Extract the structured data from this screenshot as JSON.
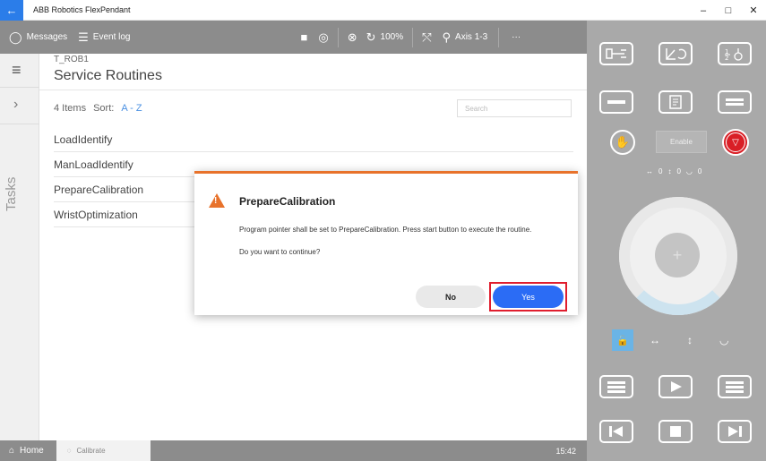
{
  "window": {
    "title": "ABB Robotics FlexPendant",
    "back_icon": "arrow-left-icon",
    "minimize": "–",
    "maximize": "□",
    "close": "✕"
  },
  "toolbar": {
    "messages_label": "Messages",
    "eventlog_label": "Event log",
    "speed_label": "100%",
    "axis_label": "Axis 1-3",
    "more_label": "···"
  },
  "rail": {
    "tasks_label": "Tasks"
  },
  "header": {
    "robot": "T_ROB1",
    "title": "Service Routines"
  },
  "listbar": {
    "count_label": "4 Items",
    "sort_label": "Sort:",
    "sort_value": "A - Z",
    "search_placeholder": "Search"
  },
  "routines": [
    {
      "label": "LoadIdentify"
    },
    {
      "label": "ManLoadIdentify"
    },
    {
      "label": "PrepareCalibration"
    },
    {
      "label": "WristOptimization"
    }
  ],
  "statusbar": {
    "home_label": "Home",
    "calibrate_label": "Calibrate",
    "time": "15:42"
  },
  "dialog": {
    "title": "PrepareCalibration",
    "message": "Program pointer shall be set to PrepareCalibration. Press start button to execute the routine.",
    "question": "Do you want to continue?",
    "no_label": "No",
    "yes_label": "Yes",
    "accent_color": "#e8722b",
    "yes_color": "#2b6cf5",
    "highlight_color": "#e01e2e"
  },
  "pendant": {
    "enable_label": "Enable",
    "readout": [
      "↔",
      "0",
      "↕",
      "0",
      "◡",
      "0"
    ],
    "lock_axes": [
      "↔",
      "↕",
      "◡"
    ]
  }
}
